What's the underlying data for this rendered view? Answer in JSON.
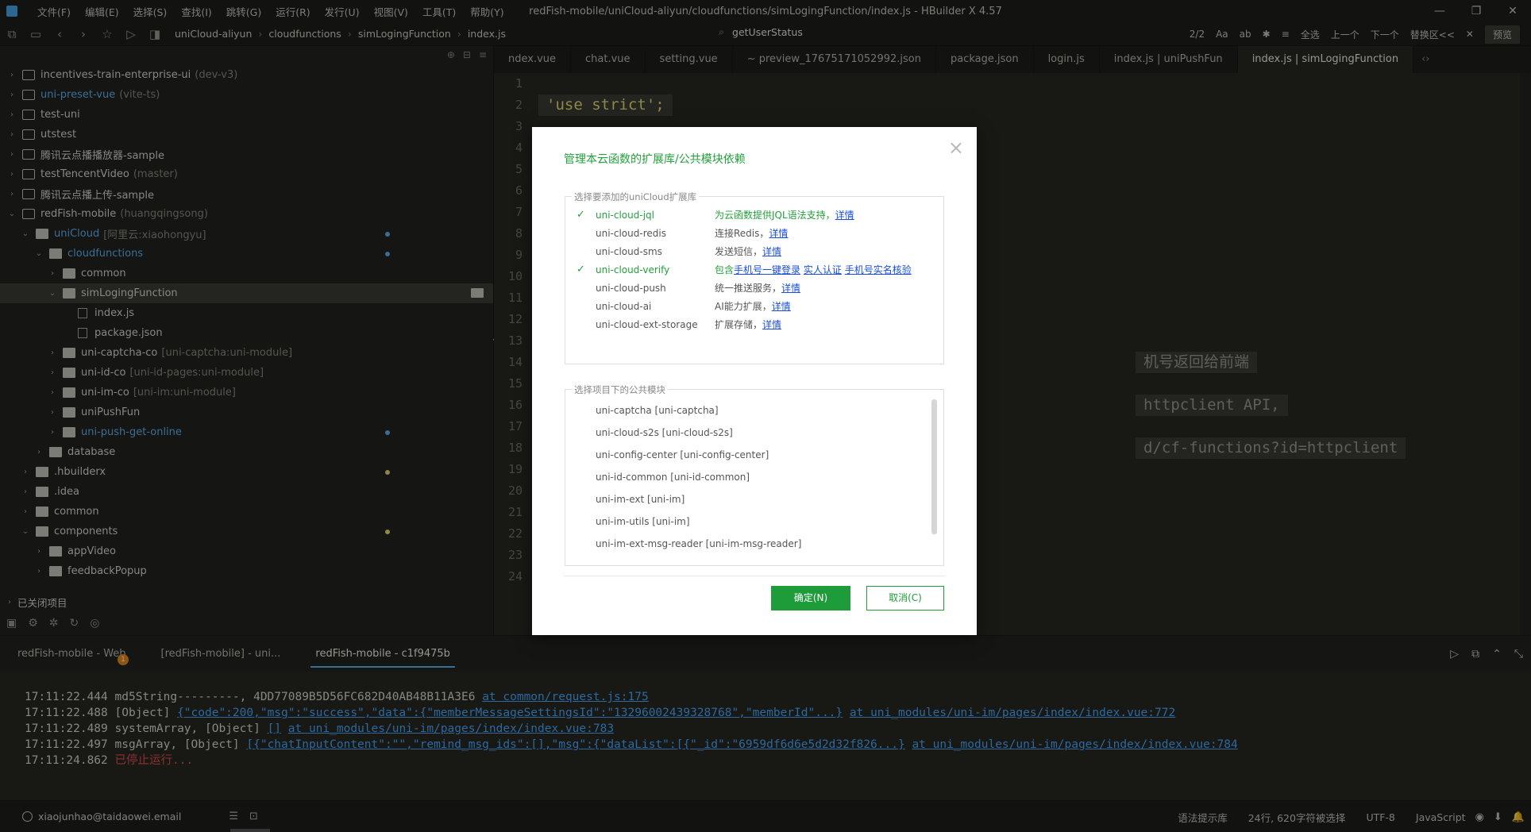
{
  "window": {
    "title": "redFish-mobile/uniCloud-aliyun/cloudfunctions/simLogingFunction/index.js - HBuilder X 4.57",
    "controls": [
      "—",
      "❐",
      "✕"
    ]
  },
  "menu": [
    "文件(F)",
    "编辑(E)",
    "选择(S)",
    "查找(I)",
    "跳转(G)",
    "运行(R)",
    "发行(U)",
    "视图(V)",
    "工具(T)",
    "帮助(Y)"
  ],
  "toolbar": {
    "icons": [
      "⧉",
      "▭",
      "‹",
      "›",
      "☆",
      "▷",
      "◨"
    ],
    "breadcrumb": [
      "uniCloud-aliyun",
      "cloudfunctions",
      "simLogingFunction",
      "index.js"
    ],
    "search_value": "getUserStatus",
    "find_count": "2/2",
    "find_opts": [
      "Aa",
      "ab",
      "✱",
      "≡",
      "全选",
      "上一个",
      "下一个",
      "替换区<<",
      "✕"
    ],
    "preview": "预览"
  },
  "sidebar": {
    "tools": [
      "⊕",
      "⊟",
      "≡"
    ],
    "tree": [
      {
        "indent": 0,
        "chev": "›",
        "icon": "proj",
        "name": "incentives-train-enterprise-ui",
        "meta": "(dev-v3)",
        "color": "normal",
        "dot": ""
      },
      {
        "indent": 0,
        "chev": "›",
        "icon": "proj",
        "name": "uni-preset-vue",
        "meta": "(vite-ts)",
        "color": "blue",
        "dot": ""
      },
      {
        "indent": 0,
        "chev": "›",
        "icon": "proj",
        "name": "test-uni",
        "meta": "",
        "color": "normal",
        "dot": ""
      },
      {
        "indent": 0,
        "chev": "›",
        "icon": "proj",
        "name": "utstest",
        "meta": "",
        "color": "normal",
        "dot": ""
      },
      {
        "indent": 0,
        "chev": "›",
        "icon": "proj",
        "name": "腾讯云点播播放器-sample",
        "meta": "",
        "color": "normal",
        "dot": ""
      },
      {
        "indent": 0,
        "chev": "›",
        "icon": "proj",
        "name": "testTencentVideo",
        "meta": "(master)",
        "color": "normal",
        "dot": ""
      },
      {
        "indent": 0,
        "chev": "›",
        "icon": "proj",
        "name": "腾讯云点播上传-sample",
        "meta": "",
        "color": "normal",
        "dot": ""
      },
      {
        "indent": 0,
        "chev": "⌄",
        "icon": "proj",
        "name": "redFish-mobile",
        "meta": "(huangqingsong)",
        "color": "normal",
        "dot": ""
      },
      {
        "indent": 1,
        "chev": "⌄",
        "icon": "folder",
        "name": "uniCloud",
        "meta": "[阿里云:xiaohongyu]",
        "color": "blue",
        "dot": "#5eb2f0"
      },
      {
        "indent": 2,
        "chev": "⌄",
        "icon": "folder",
        "name": "cloudfunctions",
        "meta": "",
        "color": "blue",
        "dot": "#5eb2f0"
      },
      {
        "indent": 3,
        "chev": "›",
        "icon": "folder",
        "name": "common",
        "meta": "",
        "color": "normal",
        "dot": ""
      },
      {
        "indent": 3,
        "chev": "⌄",
        "icon": "folder",
        "name": "simLogingFunction",
        "meta": "",
        "color": "normal",
        "dot": "",
        "selected": true
      },
      {
        "indent": 4,
        "chev": "",
        "icon": "file",
        "name": "index.js",
        "meta": "",
        "color": "normal",
        "dot": ""
      },
      {
        "indent": 4,
        "chev": "",
        "icon": "file",
        "name": "package.json",
        "meta": "",
        "color": "normal",
        "dot": ""
      },
      {
        "indent": 3,
        "chev": "›",
        "icon": "folder",
        "name": "uni-captcha-co",
        "meta": "[uni-captcha:uni-module]",
        "color": "normal",
        "dot": ""
      },
      {
        "indent": 3,
        "chev": "›",
        "icon": "folder",
        "name": "uni-id-co",
        "meta": "[uni-id-pages:uni-module]",
        "color": "normal",
        "dot": ""
      },
      {
        "indent": 3,
        "chev": "›",
        "icon": "folder",
        "name": "uni-im-co",
        "meta": "[uni-im:uni-module]",
        "color": "normal",
        "dot": ""
      },
      {
        "indent": 3,
        "chev": "›",
        "icon": "folder",
        "name": "uniPushFun",
        "meta": "",
        "color": "normal",
        "dot": ""
      },
      {
        "indent": 3,
        "chev": "›",
        "icon": "folder",
        "name": "uni-push-get-online",
        "meta": "",
        "color": "blue",
        "dot": "#5eb2f0"
      },
      {
        "indent": 2,
        "chev": "›",
        "icon": "folder",
        "name": "database",
        "meta": "",
        "color": "normal",
        "dot": ""
      },
      {
        "indent": 1,
        "chev": "›",
        "icon": "folder",
        "name": ".hbuilderx",
        "meta": "",
        "color": "normal",
        "dot": "#e6db74"
      },
      {
        "indent": 1,
        "chev": "›",
        "icon": "folder",
        "name": ".idea",
        "meta": "",
        "color": "normal",
        "dot": ""
      },
      {
        "indent": 1,
        "chev": "›",
        "icon": "folder",
        "name": "common",
        "meta": "",
        "color": "normal",
        "dot": ""
      },
      {
        "indent": 1,
        "chev": "⌄",
        "icon": "folder",
        "name": "components",
        "meta": "",
        "color": "normal",
        "dot": "#e6db74"
      },
      {
        "indent": 2,
        "chev": "›",
        "icon": "folder",
        "name": "appVideo",
        "meta": "",
        "color": "normal",
        "dot": ""
      },
      {
        "indent": 2,
        "chev": "›",
        "icon": "folder",
        "name": "feedbackPopup",
        "meta": "",
        "color": "normal",
        "dot": ""
      }
    ],
    "closed_projects": "已关闭项目",
    "bottom_icons": [
      "▣",
      "⚙",
      "✲",
      "↻",
      "◎"
    ]
  },
  "editor": {
    "tabs": [
      "ndex.vue",
      "chat.vue",
      "setting.vue",
      "~ preview_17675171052992.json",
      "package.json",
      "login.js",
      "index.js | uniPushFun",
      "index.js | simLogingFunction"
    ],
    "active_tab": 7,
    "line_numbers": [
      "1",
      "2",
      "3",
      "4",
      "5",
      "6",
      "7",
      "8",
      "9",
      "10",
      "11",
      "12",
      "13",
      "14",
      "15",
      "16",
      "17",
      "18",
      "19",
      "20",
      "21",
      "22",
      "23",
      "24"
    ],
    "code": [
      {
        "line": 2,
        "text": "'use strict';",
        "cls": "str"
      },
      {
        "line": 14,
        "text": "机号返回给前端",
        "cls": "cmt"
      },
      {
        "line": 16,
        "text": "httpclient API,",
        "cls": "cmt"
      },
      {
        "line": 18,
        "text": "d/cf-functions?id=httpclient",
        "cls": "cmt"
      }
    ]
  },
  "dialog": {
    "title": "管理本云函数的扩展库/公共模块依赖",
    "close": "×",
    "ext_legend": "选择要添加的uniCloud扩展库",
    "extensions": [
      {
        "name": "uni-cloud-jql",
        "desc": "为云函数提供JQL语法支持，",
        "links": [
          "详情"
        ],
        "checked": true
      },
      {
        "name": "uni-cloud-redis",
        "desc": "连接Redis，",
        "links": [
          "详情"
        ],
        "checked": false
      },
      {
        "name": "uni-cloud-sms",
        "desc": "发送短信，",
        "links": [
          "详情"
        ],
        "checked": false
      },
      {
        "name": "uni-cloud-verify",
        "desc": "包含",
        "links": [
          "手机号一键登录",
          "实人认证",
          "手机号实名核验"
        ],
        "checked": true
      },
      {
        "name": "uni-cloud-push",
        "desc": "统一推送服务，",
        "links": [
          "详情"
        ],
        "checked": false
      },
      {
        "name": "uni-cloud-ai",
        "desc": "AI能力扩展，",
        "links": [
          "详情"
        ],
        "checked": false
      },
      {
        "name": "uni-cloud-ext-storage",
        "desc": "扩展存储，",
        "links": [
          "详情"
        ],
        "checked": false
      }
    ],
    "mod_legend": "选择项目下的公共模块",
    "modules": [
      "uni-captcha [uni-captcha]",
      "uni-cloud-s2s [uni-cloud-s2s]",
      "uni-config-center [uni-config-center]",
      "uni-id-common [uni-id-common]",
      "uni-im-ext [uni-im]",
      "uni-im-utils [uni-im]",
      "uni-im-ext-msg-reader [uni-im-msg-reader]"
    ],
    "confirm": "确定(N)",
    "cancel": "取消(C)"
  },
  "console": {
    "tabs": [
      "redFish-mobile - Web",
      "[redFish-mobile] - uni...",
      "redFish-mobile - c1f9475b"
    ],
    "active_tab": 2,
    "badge": "1",
    "actions": [
      "▷",
      "⧉",
      "⌃",
      "⤡"
    ],
    "lines": [
      {
        "time": "17:11:22.444",
        "msg": "md5String---------,  4DD77089B5D56FC682D40AB48B11A3E6 ",
        "links": [
          "at common/request.js:175"
        ],
        "stop": false
      },
      {
        "time": "17:11:22.488",
        "msg": "[Object] ",
        "links": [
          "{\"code\":200,\"msg\":\"success\",\"data\":{\"memberMessageSettingsId\":\"13296002439328768\",\"memberId\"...}",
          "at uni_modules/uni-im/pages/index/index.vue:772"
        ],
        "stop": false
      },
      {
        "time": "17:11:22.489",
        "msg": "systemArray,  [Object] ",
        "links": [
          "[]",
          "at uni_modules/uni-im/pages/index/index.vue:783"
        ],
        "stop": false
      },
      {
        "time": "17:11:22.497",
        "msg": "msgArray,  [Object] ",
        "links": [
          "[{\"chatInputContent\":\"\",\"remind_msg_ids\":[],\"msg\":{\"dataList\":[{\"_id\":\"6959df6d6e5d2d32f826...}",
          "at uni_modules/uni-im/pages/index/index.vue:784"
        ],
        "stop": false
      },
      {
        "time": "17:11:24.862",
        "msg": "已停止运行...",
        "links": [],
        "stop": true
      }
    ]
  },
  "statusbar": {
    "user": "xiaojunhao@taidaowei.email",
    "icons": [
      "☰",
      "⊡"
    ],
    "hint": "语法提示库",
    "position": "24行, 620字符被选择",
    "encoding": "UTF-8",
    "language": "JavaScript",
    "right_icons": [
      "◉",
      "⬇",
      "🔔"
    ]
  }
}
